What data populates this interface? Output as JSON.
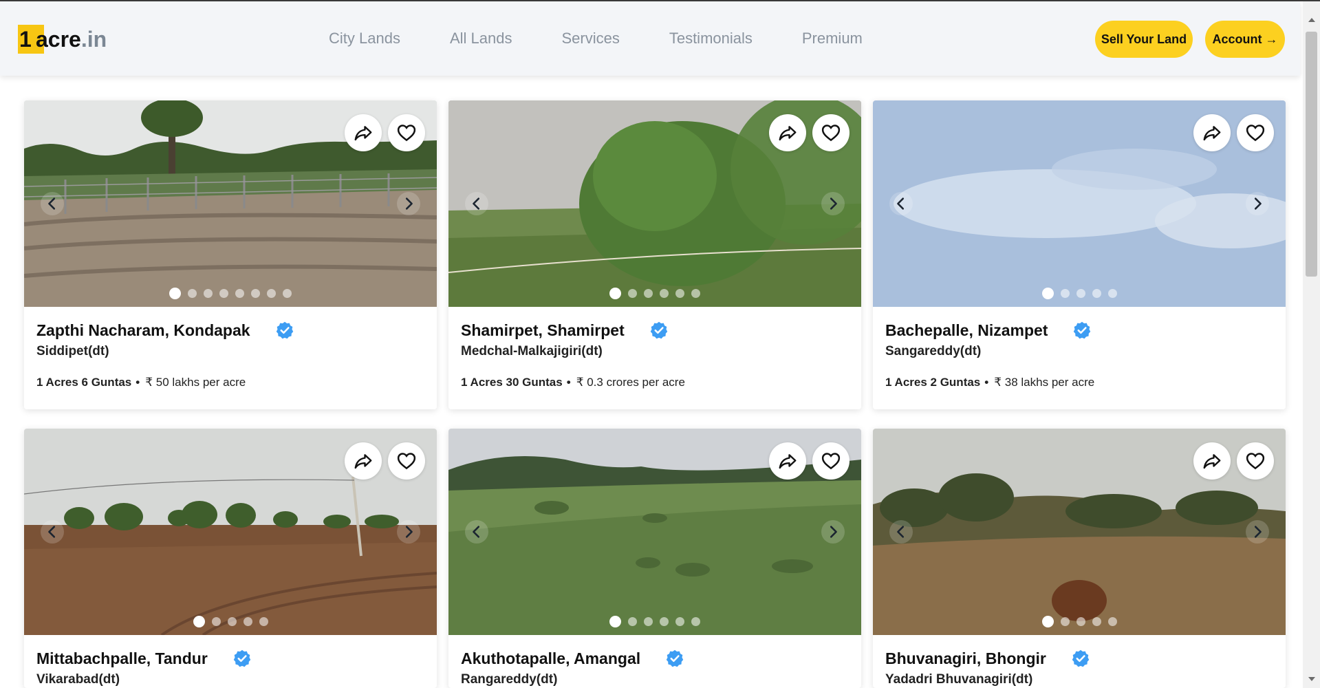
{
  "brand": {
    "logo_first": "1",
    "logo_main": "acre",
    "logo_suffix": ".in"
  },
  "nav": {
    "links": [
      "City Lands",
      "All Lands",
      "Services",
      "Testimonials",
      "Premium"
    ]
  },
  "actions": {
    "sell_label": "Sell Your Land",
    "account_label": "Account →"
  },
  "colors": {
    "accent": "#fcd020",
    "verified": "#3d9df3"
  },
  "icons": {
    "share": "share-icon",
    "heart": "heart-icon",
    "verified": "verified-badge-icon",
    "prev": "chevron-left-icon",
    "next": "chevron-right-icon"
  },
  "listings": [
    {
      "title": "Zapthi Nacharam, Kondapak",
      "district": "Siddipet(dt)",
      "size": "1 Acres 6 Guntas",
      "price": "₹ 50 lakhs per acre",
      "photo_count": 8,
      "active_photo": 1
    },
    {
      "title": "Shamirpet, Shamirpet",
      "district": "Medchal-Malkajigiri(dt)",
      "size": "1 Acres 30 Guntas",
      "price": "₹ 0.3 crores per acre",
      "photo_count": 6,
      "active_photo": 1
    },
    {
      "title": "Bachepalle, Nizampet",
      "district": "Sangareddy(dt)",
      "size": "1 Acres 2 Guntas",
      "price": "₹ 38 lakhs per acre",
      "photo_count": 5,
      "active_photo": 1
    },
    {
      "title": "Mittabachpalle, Tandur",
      "district": "Vikarabad(dt)",
      "size": "",
      "price": "",
      "photo_count": 5,
      "active_photo": 1
    },
    {
      "title": "Akuthotapalle, Amangal",
      "district": "Rangareddy(dt)",
      "size": "",
      "price": "",
      "photo_count": 6,
      "active_photo": 1
    },
    {
      "title": "Bhuvanagiri, Bhongir",
      "district": "Yadadri Bhuvanagiri(dt)",
      "size": "",
      "price": "",
      "photo_count": 5,
      "active_photo": 1
    }
  ]
}
